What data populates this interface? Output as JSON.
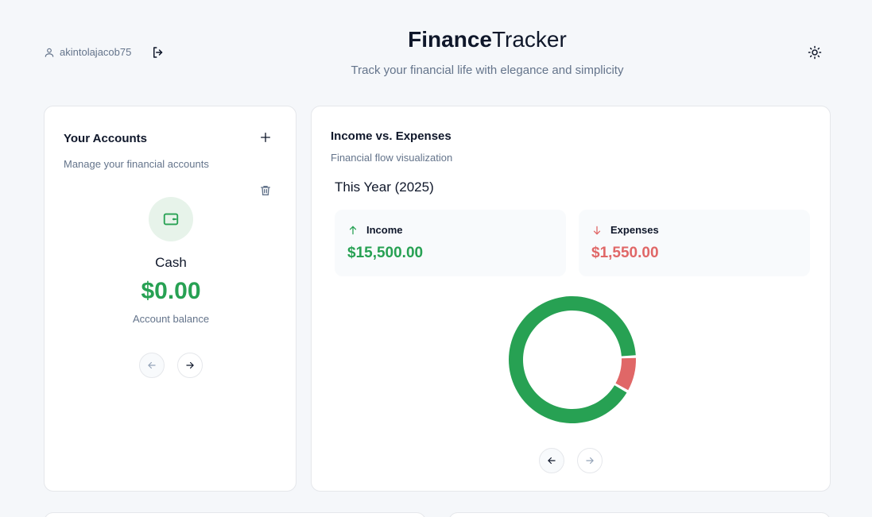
{
  "header": {
    "username": "akintolajacob75",
    "brand_bold": "Finance",
    "brand_light": "Tracker",
    "tagline": "Track your financial life with elegance and simplicity",
    "icons": [
      "user-icon",
      "logout-icon",
      "sun-icon"
    ]
  },
  "accounts": {
    "title": "Your Accounts",
    "subtitle": "Manage your financial accounts",
    "account_name": "Cash",
    "balance": "$0.00",
    "balance_label": "Account balance",
    "icons": [
      "plus-icon",
      "trash-icon",
      "wallet-icon",
      "arrow-left-icon",
      "arrow-right-icon"
    ]
  },
  "flow": {
    "title": "Income vs. Expenses",
    "subtitle": "Financial flow visualization",
    "period": "This Year (2025)",
    "income_label": "Income",
    "income_value": "$15,500.00",
    "expenses_label": "Expenses",
    "expenses_value": "$1,550.00"
  },
  "colors": {
    "income": "#27a153",
    "expenses": "#e06767",
    "muted_text": "#64748b",
    "background": "#f5f7fa"
  },
  "chart_data": {
    "type": "pie",
    "categories": [
      "Income",
      "Expenses"
    ],
    "values": [
      15500,
      1550
    ],
    "title": ""
  }
}
